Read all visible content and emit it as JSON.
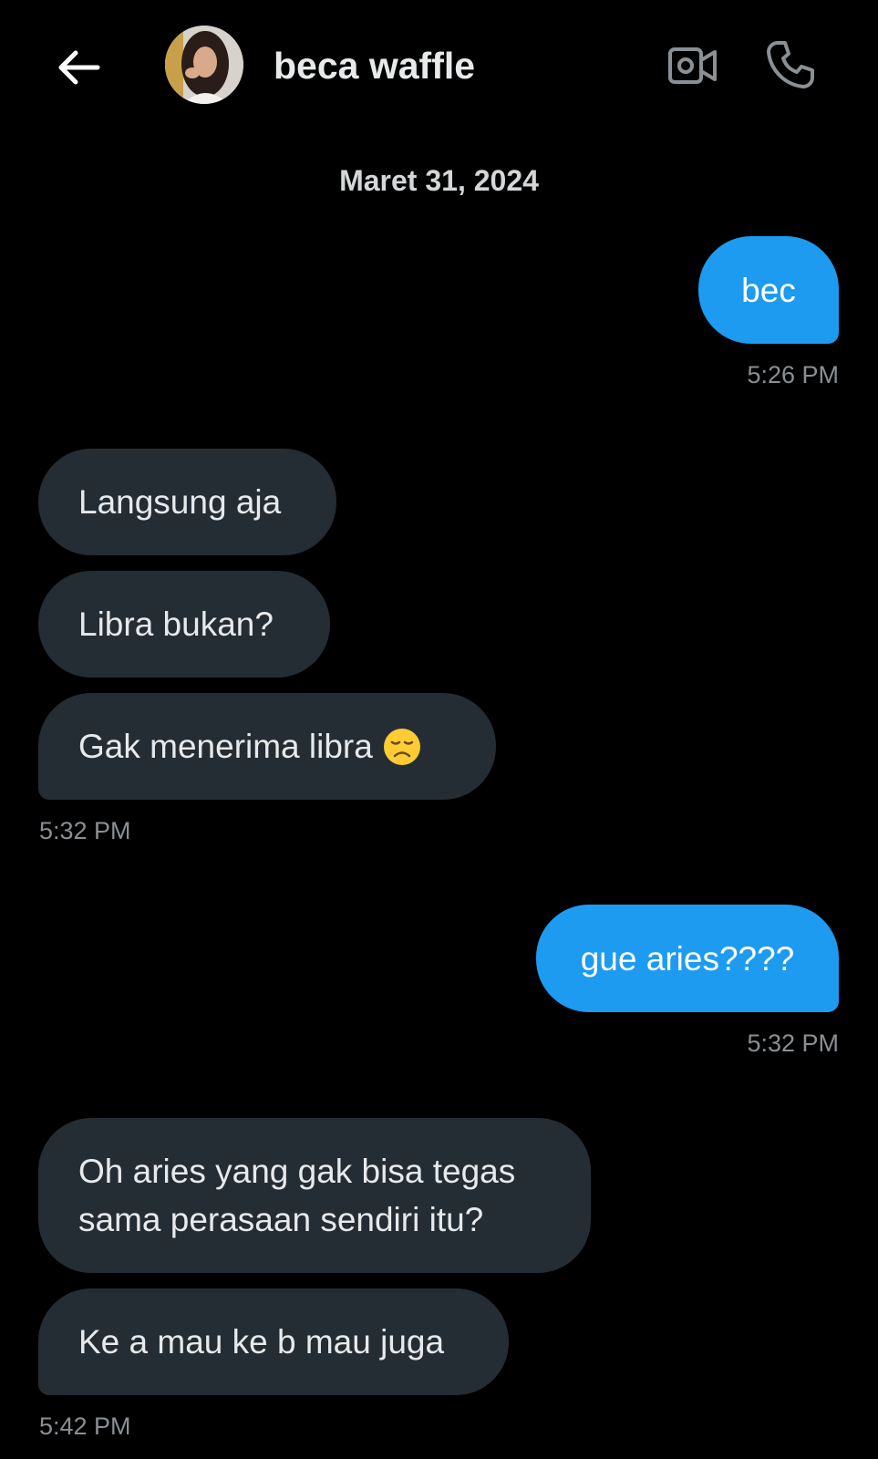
{
  "header": {
    "contact_name": "beca waffle",
    "back_icon": "arrow-left-icon",
    "video_icon": "video-camera-icon",
    "call_icon": "phone-icon"
  },
  "conversation": {
    "date": "Maret 31, 2024",
    "messages": [
      {
        "direction": "out",
        "text": "bec"
      },
      {
        "direction": "in",
        "text": "Langsung aja"
      },
      {
        "direction": "in",
        "text": "Libra bukan?"
      },
      {
        "direction": "in",
        "text": "Gak menerima libra",
        "emoji": "disappointed-face"
      },
      {
        "direction": "out",
        "text": "gue aries????"
      },
      {
        "direction": "in",
        "text": "Oh aries yang gak bisa tegas sama perasaan sendiri itu?"
      },
      {
        "direction": "in",
        "text": "Ke a mau ke b mau juga"
      }
    ],
    "timestamps": [
      "5:26 PM",
      "5:32 PM",
      "5:32 PM",
      "5:42 PM"
    ]
  },
  "colors": {
    "background": "#000000",
    "outgoing_bubble": "#1d9bf0",
    "incoming_bubble": "#252d34",
    "timestamp": "#8a8f94"
  }
}
